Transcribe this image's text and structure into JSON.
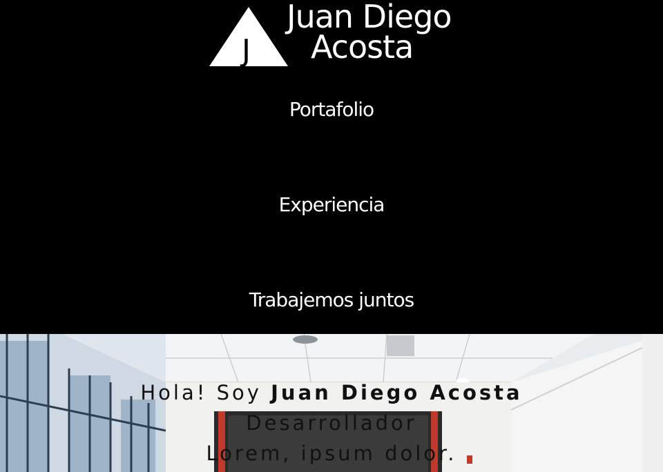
{
  "logo": {
    "line1": "Juan Diego",
    "line2": "Acosta",
    "mark_letter": "J",
    "icon": "triangle-logo-icon"
  },
  "nav": {
    "items": [
      {
        "label": "Portafolio"
      },
      {
        "label": "Experiencia"
      },
      {
        "label": "Trabajemos juntos"
      }
    ]
  },
  "hero": {
    "greeting": "Hola! Soy",
    "name": "Juan Diego Acosta",
    "role": "Desarrollador",
    "tagline": "Lorem, ipsum dolor."
  },
  "colors": {
    "header_bg": "#000000",
    "nav_text": "#ffffff",
    "hero_text": "#111111"
  }
}
